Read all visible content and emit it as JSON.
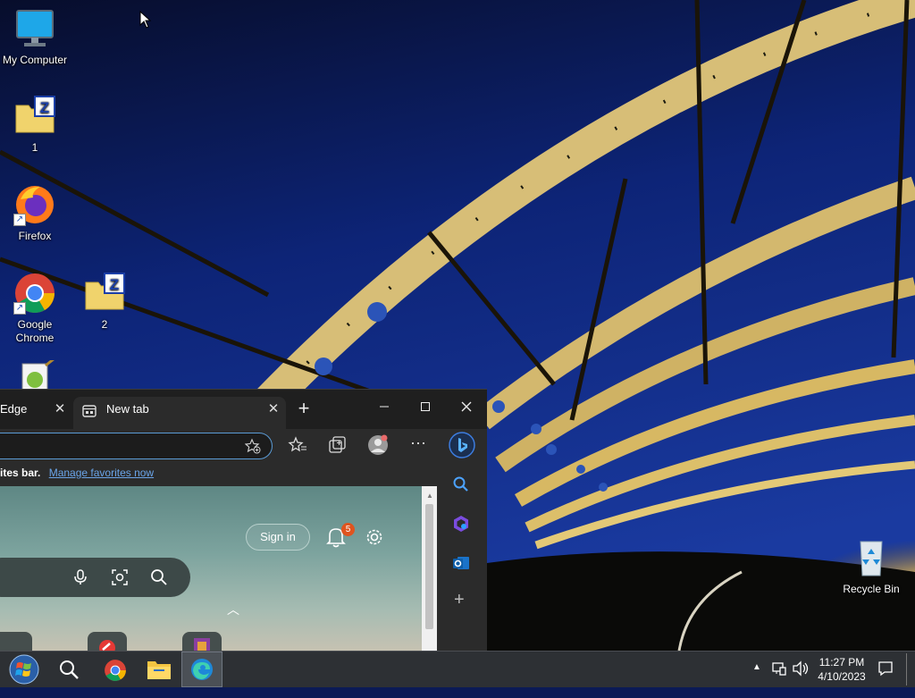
{
  "desktop": {
    "icons": [
      {
        "label": "My Computer",
        "icon": "monitor-icon"
      },
      {
        "label": "1",
        "icon": "zip-folder-icon"
      },
      {
        "label": "Firefox",
        "icon": "firefox-icon"
      },
      {
        "label": "Google Chrome",
        "icon": "chrome-icon"
      },
      {
        "label": "2",
        "icon": "zip-folder-icon"
      },
      {
        "label": "Recycle Bin",
        "icon": "recycle-bin-icon"
      }
    ]
  },
  "browser": {
    "tabs": [
      {
        "label": "Edge",
        "active": false
      },
      {
        "label": "New tab",
        "active": true
      }
    ],
    "new_tab_symbol": "+",
    "favorites_bar": {
      "text": "ites bar.",
      "link": "Manage favorites now"
    },
    "page": {
      "sign_in": "Sign in",
      "notification_count": "5"
    }
  },
  "taskbar": {
    "time": "11:27 PM",
    "date": "4/10/2023",
    "apps": [
      "start-icon",
      "search-icon",
      "chrome-icon",
      "file-explorer-icon",
      "edge-icon"
    ]
  },
  "colors": {
    "accent": "#5b9bd5",
    "notification_badge": "#e0541f",
    "taskbar": "#2d3034"
  }
}
